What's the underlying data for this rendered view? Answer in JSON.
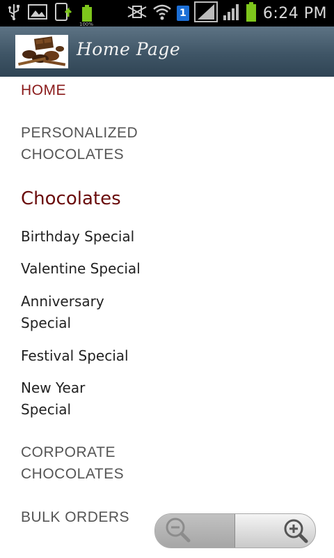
{
  "status_bar": {
    "time": "6:24 PM",
    "sim_slot": "1",
    "battery_small_label": "100%",
    "battery_color": "#7ec61c"
  },
  "action_bar": {
    "title": "Home Page",
    "logo_icon": "chocolate-image"
  },
  "menu": {
    "home": "HOME",
    "personalized": [
      "PERSONALIZED",
      "CHOCOLATES"
    ],
    "section_title": "Chocolates",
    "sub_items": [
      [
        "Birthday Special"
      ],
      [
        "Valentine Special"
      ],
      [
        "Anniversary",
        "Special"
      ],
      [
        "Festival Special"
      ],
      [
        "New Year",
        "Special"
      ]
    ],
    "corporate": [
      "CORPORATE",
      "CHOCOLATES"
    ],
    "bulk": "BULK ORDERS"
  },
  "zoom": {
    "zoom_out_icon": "zoom-out-icon",
    "zoom_in_icon": "zoom-in-icon"
  },
  "colors": {
    "active_nav": "#8a1a1a",
    "section_title": "#6a0c0c",
    "action_bar": "#3f5566"
  }
}
